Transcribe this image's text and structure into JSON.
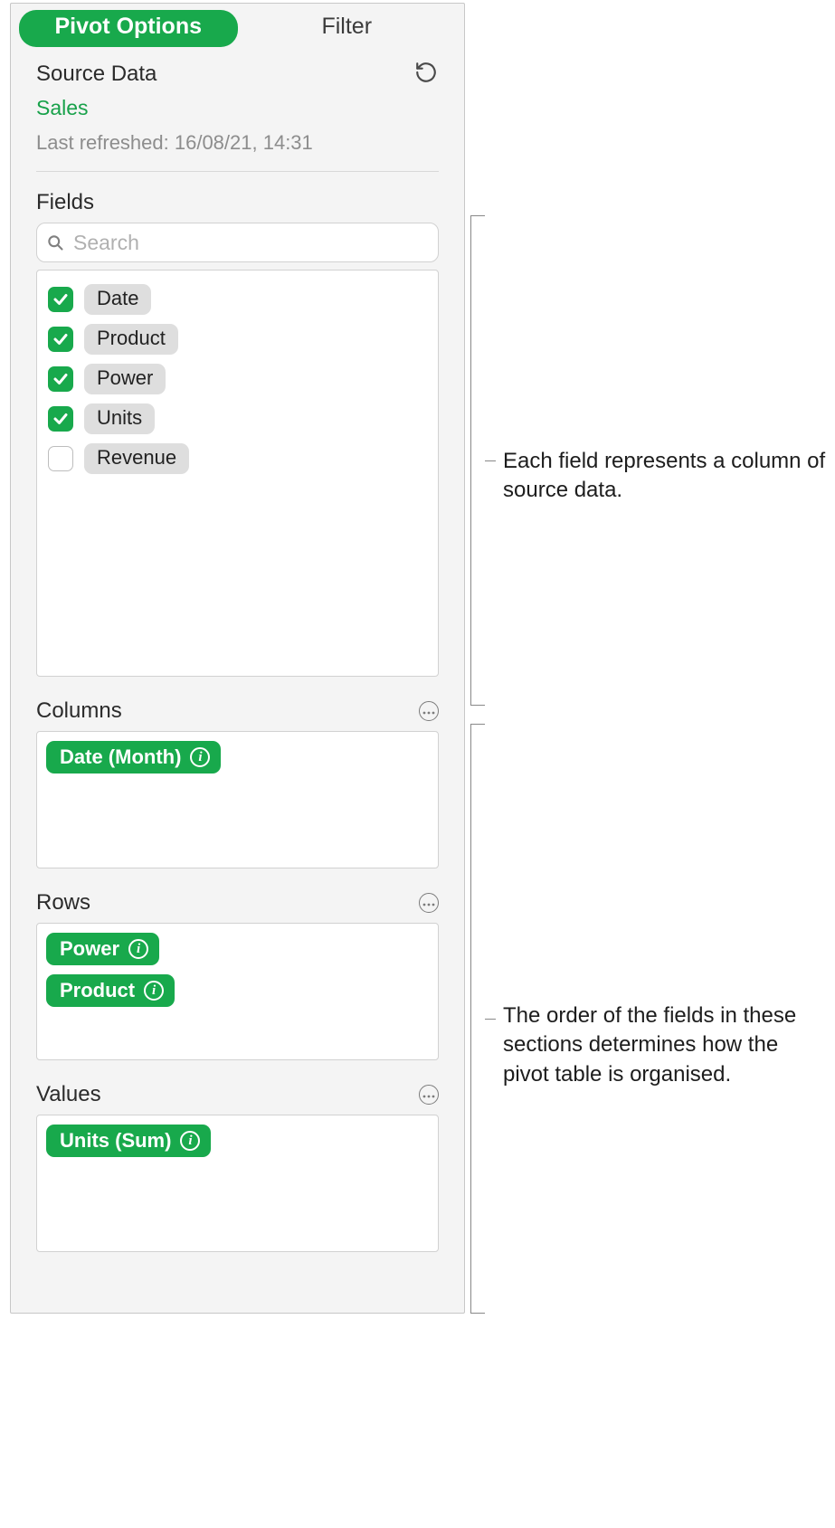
{
  "tabs": {
    "pivot": "Pivot Options",
    "filter": "Filter",
    "active": 0
  },
  "source": {
    "title": "Source Data",
    "name": "Sales",
    "last_refreshed": "Last refreshed: 16/08/21, 14:31"
  },
  "fields": {
    "title": "Fields",
    "search_placeholder": "Search",
    "items": [
      {
        "label": "Date",
        "checked": true
      },
      {
        "label": "Product",
        "checked": true
      },
      {
        "label": "Power",
        "checked": true
      },
      {
        "label": "Units",
        "checked": true
      },
      {
        "label": "Revenue",
        "checked": false
      }
    ]
  },
  "columns": {
    "title": "Columns",
    "tags": [
      "Date (Month)"
    ]
  },
  "rows": {
    "title": "Rows",
    "tags": [
      "Power",
      "Product"
    ]
  },
  "values": {
    "title": "Values",
    "tags": [
      "Units (Sum)"
    ]
  },
  "annotations": {
    "fields_note": "Each field represents a column of source data.",
    "zones_note": "The order of the fields in these sections determines how the pivot table is organised."
  }
}
